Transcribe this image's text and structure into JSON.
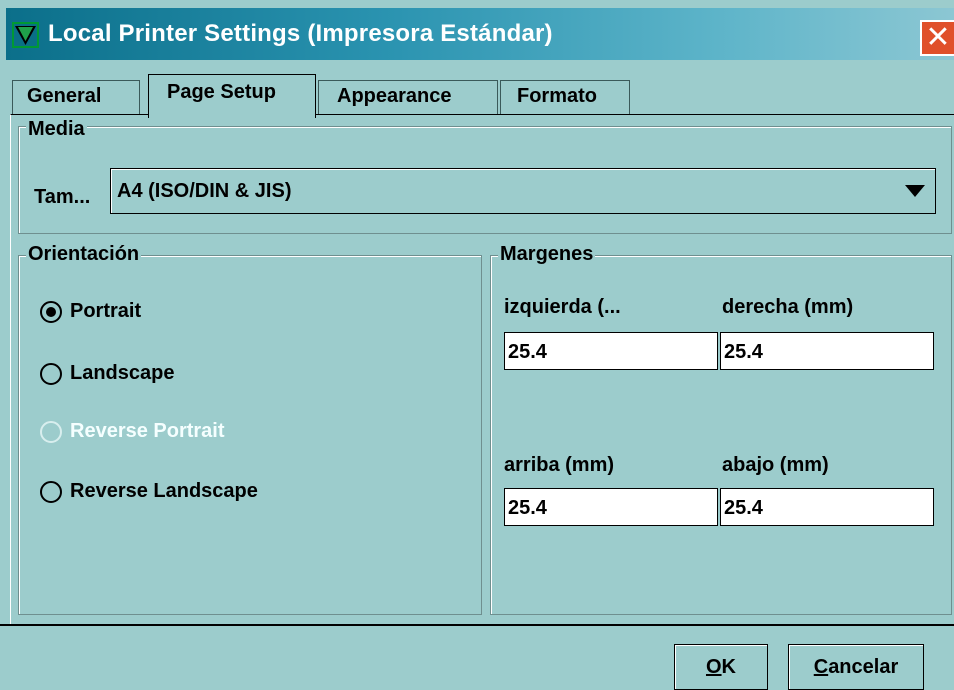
{
  "window": {
    "title": "Local Printer Settings (Impresora Estándar)",
    "close_glyph": "✕"
  },
  "tabs": [
    {
      "label": "General"
    },
    {
      "label": "Page Setup"
    },
    {
      "label": "Appearance"
    },
    {
      "label": "Formato"
    }
  ],
  "active_tab": "Page Setup",
  "media": {
    "legend": "Media",
    "size_label": "Tam...",
    "size_value": "A4 (ISO/DIN & JIS)"
  },
  "orientation": {
    "legend": "Orientación",
    "options": [
      {
        "label": "Portrait",
        "checked": true,
        "disabled": false
      },
      {
        "label": "Landscape",
        "checked": false,
        "disabled": false
      },
      {
        "label": "Reverse Portrait",
        "checked": false,
        "disabled": true
      },
      {
        "label": "Reverse Landscape",
        "checked": false,
        "disabled": false
      }
    ]
  },
  "margins": {
    "legend": "Margenes",
    "left_label": "izquierda (...",
    "left_value": "25.4",
    "right_label": "derecha (mm)",
    "right_value": "25.4",
    "top_label": "arriba (mm)",
    "top_value": "25.4",
    "bottom_label": "abajo (mm)",
    "bottom_value": "25.4"
  },
  "buttons": {
    "ok": {
      "mnemonic": "O",
      "rest": "K"
    },
    "cancel": {
      "mnemonic": "C",
      "rest": "ancelar"
    }
  },
  "colors": {
    "background": "#9ccccc",
    "title_gradient_start": "#0b6f8a",
    "close_button": "#e0502a"
  }
}
